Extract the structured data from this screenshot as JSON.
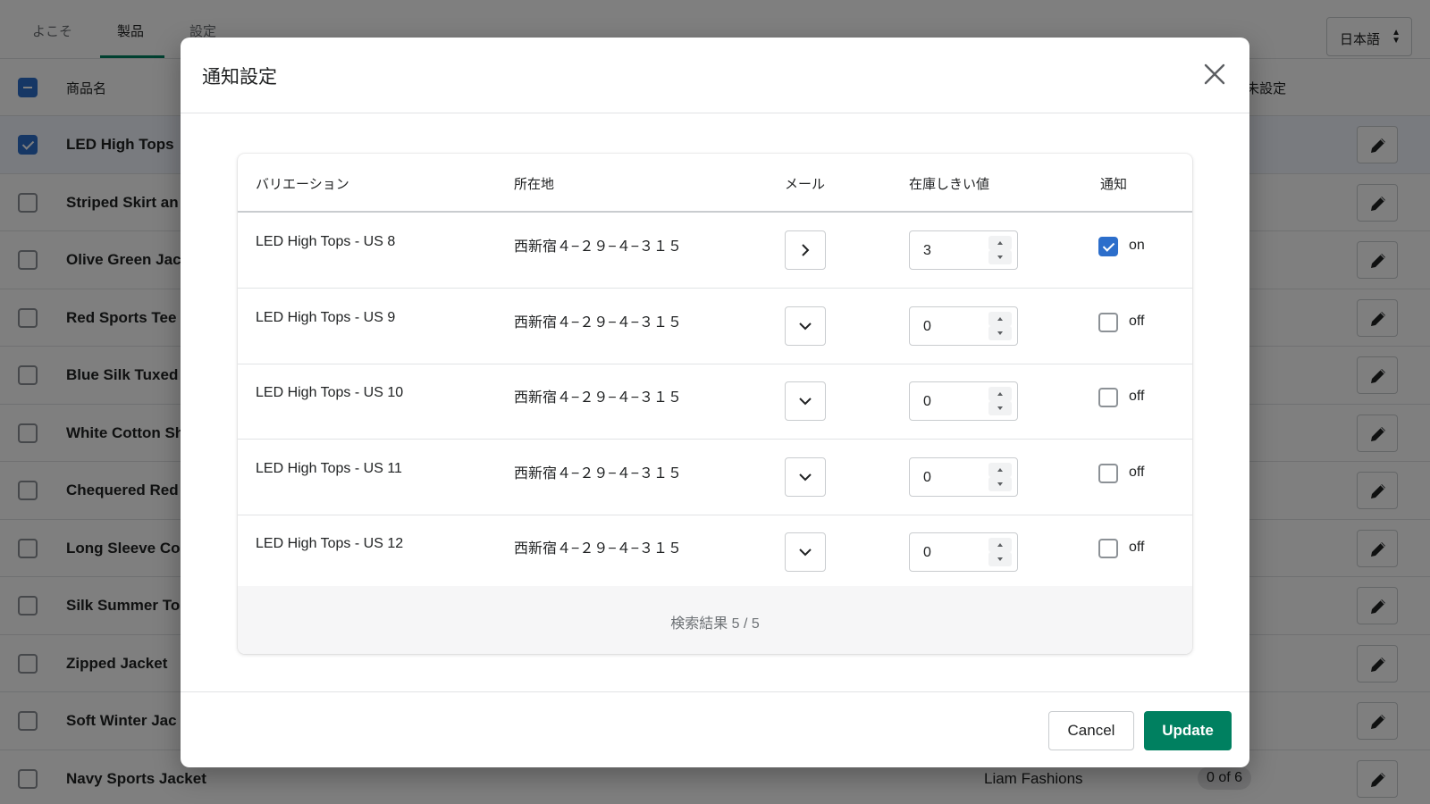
{
  "background": {
    "tabs": [
      "よこそ",
      "製品",
      "設定"
    ],
    "active_tab": "製品",
    "language": "日本語",
    "column_product_name": "商品名",
    "column_right": "/未設定",
    "products": [
      {
        "name": "LED High Tops",
        "selected": true
      },
      {
        "name": "Striped Skirt an",
        "selected": false
      },
      {
        "name": "Olive Green Jac",
        "selected": false
      },
      {
        "name": "Red Sports Tee",
        "selected": false
      },
      {
        "name": "Blue Silk Tuxed",
        "selected": false
      },
      {
        "name": "White Cotton Sh",
        "selected": false
      },
      {
        "name": "Chequered Red",
        "selected": false
      },
      {
        "name": "Long Sleeve Co",
        "selected": false
      },
      {
        "name": "Silk Summer To",
        "selected": false
      },
      {
        "name": "Zipped Jacket",
        "selected": false
      },
      {
        "name": "Soft Winter Jac",
        "selected": false
      },
      {
        "name": "Navy Sports Jacket",
        "selected": false,
        "vendor": "Liam Fashions",
        "count": "0 of 6"
      }
    ]
  },
  "modal": {
    "title": "通知設定",
    "table": {
      "headers": {
        "variation": "バリエーション",
        "location": "所在地",
        "mail": "メール",
        "threshold": "在庫しきい値",
        "notification": "通知"
      },
      "rows": [
        {
          "variation": "LED High Tops - US 8",
          "location": "西新宿４−２９−４−３１５",
          "mail_expanded": false,
          "threshold": "3",
          "notify": true,
          "notify_label": "on"
        },
        {
          "variation": "LED High Tops - US 9",
          "location": "西新宿４−２９−４−３１５",
          "mail_expanded": true,
          "threshold": "0",
          "notify": false,
          "notify_label": "off"
        },
        {
          "variation": "LED High Tops - US 10",
          "location": "西新宿４−２９−４−３１５",
          "mail_expanded": true,
          "threshold": "0",
          "notify": false,
          "notify_label": "off"
        },
        {
          "variation": "LED High Tops - US 11",
          "location": "西新宿４−２９−４−３１５",
          "mail_expanded": true,
          "threshold": "0",
          "notify": false,
          "notify_label": "off"
        },
        {
          "variation": "LED High Tops - US 12",
          "location": "西新宿４−２９−４−３１５",
          "mail_expanded": true,
          "threshold": "0",
          "notify": false,
          "notify_label": "off"
        }
      ],
      "footer": "検索結果 5 / 5"
    },
    "cancel_label": "Cancel",
    "update_label": "Update"
  },
  "colors": {
    "primary": "#008060",
    "checkbox": "#2c6ecb"
  }
}
